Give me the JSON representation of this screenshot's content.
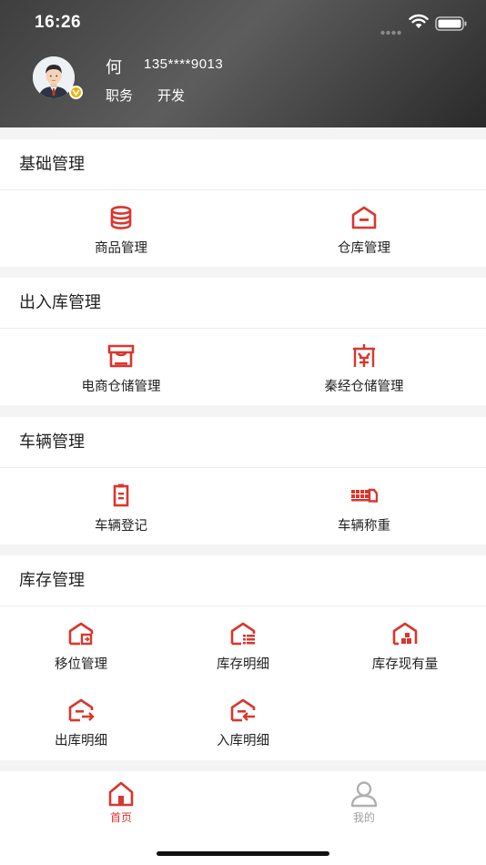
{
  "status_bar": {
    "time": "16:26"
  },
  "user": {
    "name": "何",
    "phone": "135****9013",
    "role_label": "职务",
    "role_value": "开发"
  },
  "sections": [
    {
      "title": "基础管理",
      "items": [
        {
          "label": "商品管理",
          "icon": "database-icon"
        },
        {
          "label": "仓库管理",
          "icon": "warehouse-icon"
        }
      ]
    },
    {
      "title": "出入库管理",
      "items": [
        {
          "label": "电商仓储管理",
          "icon": "store-icon"
        },
        {
          "label": "秦经仓储管理",
          "icon": "gate-icon"
        }
      ]
    },
    {
      "title": "车辆管理",
      "items": [
        {
          "label": "车辆登记",
          "icon": "clipboard-icon"
        },
        {
          "label": "车辆称重",
          "icon": "truck-icon"
        }
      ]
    },
    {
      "title": "库存管理",
      "items": [
        {
          "label": "移位管理",
          "icon": "house-move-icon"
        },
        {
          "label": "库存明细",
          "icon": "house-list-icon"
        },
        {
          "label": "库存现有量",
          "icon": "house-boxes-icon"
        },
        {
          "label": "出库明细",
          "icon": "house-out-icon"
        },
        {
          "label": "入库明细",
          "icon": "house-in-icon"
        }
      ]
    }
  ],
  "tabbar": {
    "home": {
      "label": "首页",
      "icon": "home-icon"
    },
    "mine": {
      "label": "我的",
      "icon": "user-icon"
    }
  },
  "colors": {
    "accent": "#d9362e",
    "tab_inactive": "#b0b0b0",
    "header_dark": "#3e3e3e"
  }
}
